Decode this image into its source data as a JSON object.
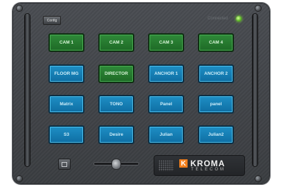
{
  "header": {
    "config_label": "Config",
    "status_label": "Connected",
    "status_color": "#4fb019"
  },
  "buttons": [
    {
      "label": "CAM 1",
      "color": "green"
    },
    {
      "label": "CAM 2",
      "color": "green"
    },
    {
      "label": "CAM 3",
      "color": "green"
    },
    {
      "label": "CAM 4",
      "color": "green"
    },
    {
      "label": "FLOOR MG",
      "color": "blue"
    },
    {
      "label": "DIRECTOR",
      "color": "green"
    },
    {
      "label": "ANCHOR 1",
      "color": "blue"
    },
    {
      "label": "ANCHOR 2",
      "color": "blue"
    },
    {
      "label": "Matrix",
      "color": "blue"
    },
    {
      "label": "TONO",
      "color": "blue"
    },
    {
      "label": "Panel",
      "color": "blue"
    },
    {
      "label": "panel",
      "color": "blue"
    },
    {
      "label": "S3",
      "color": "blue"
    },
    {
      "label": "Desire",
      "color": "blue"
    },
    {
      "label": "Julian",
      "color": "blue"
    },
    {
      "label": "Julian2",
      "color": "blue"
    }
  ],
  "footer": {
    "slider_value": 0.45,
    "logo_letter": "K",
    "logo_name": "KROMA",
    "logo_sub": "TELECOM"
  }
}
